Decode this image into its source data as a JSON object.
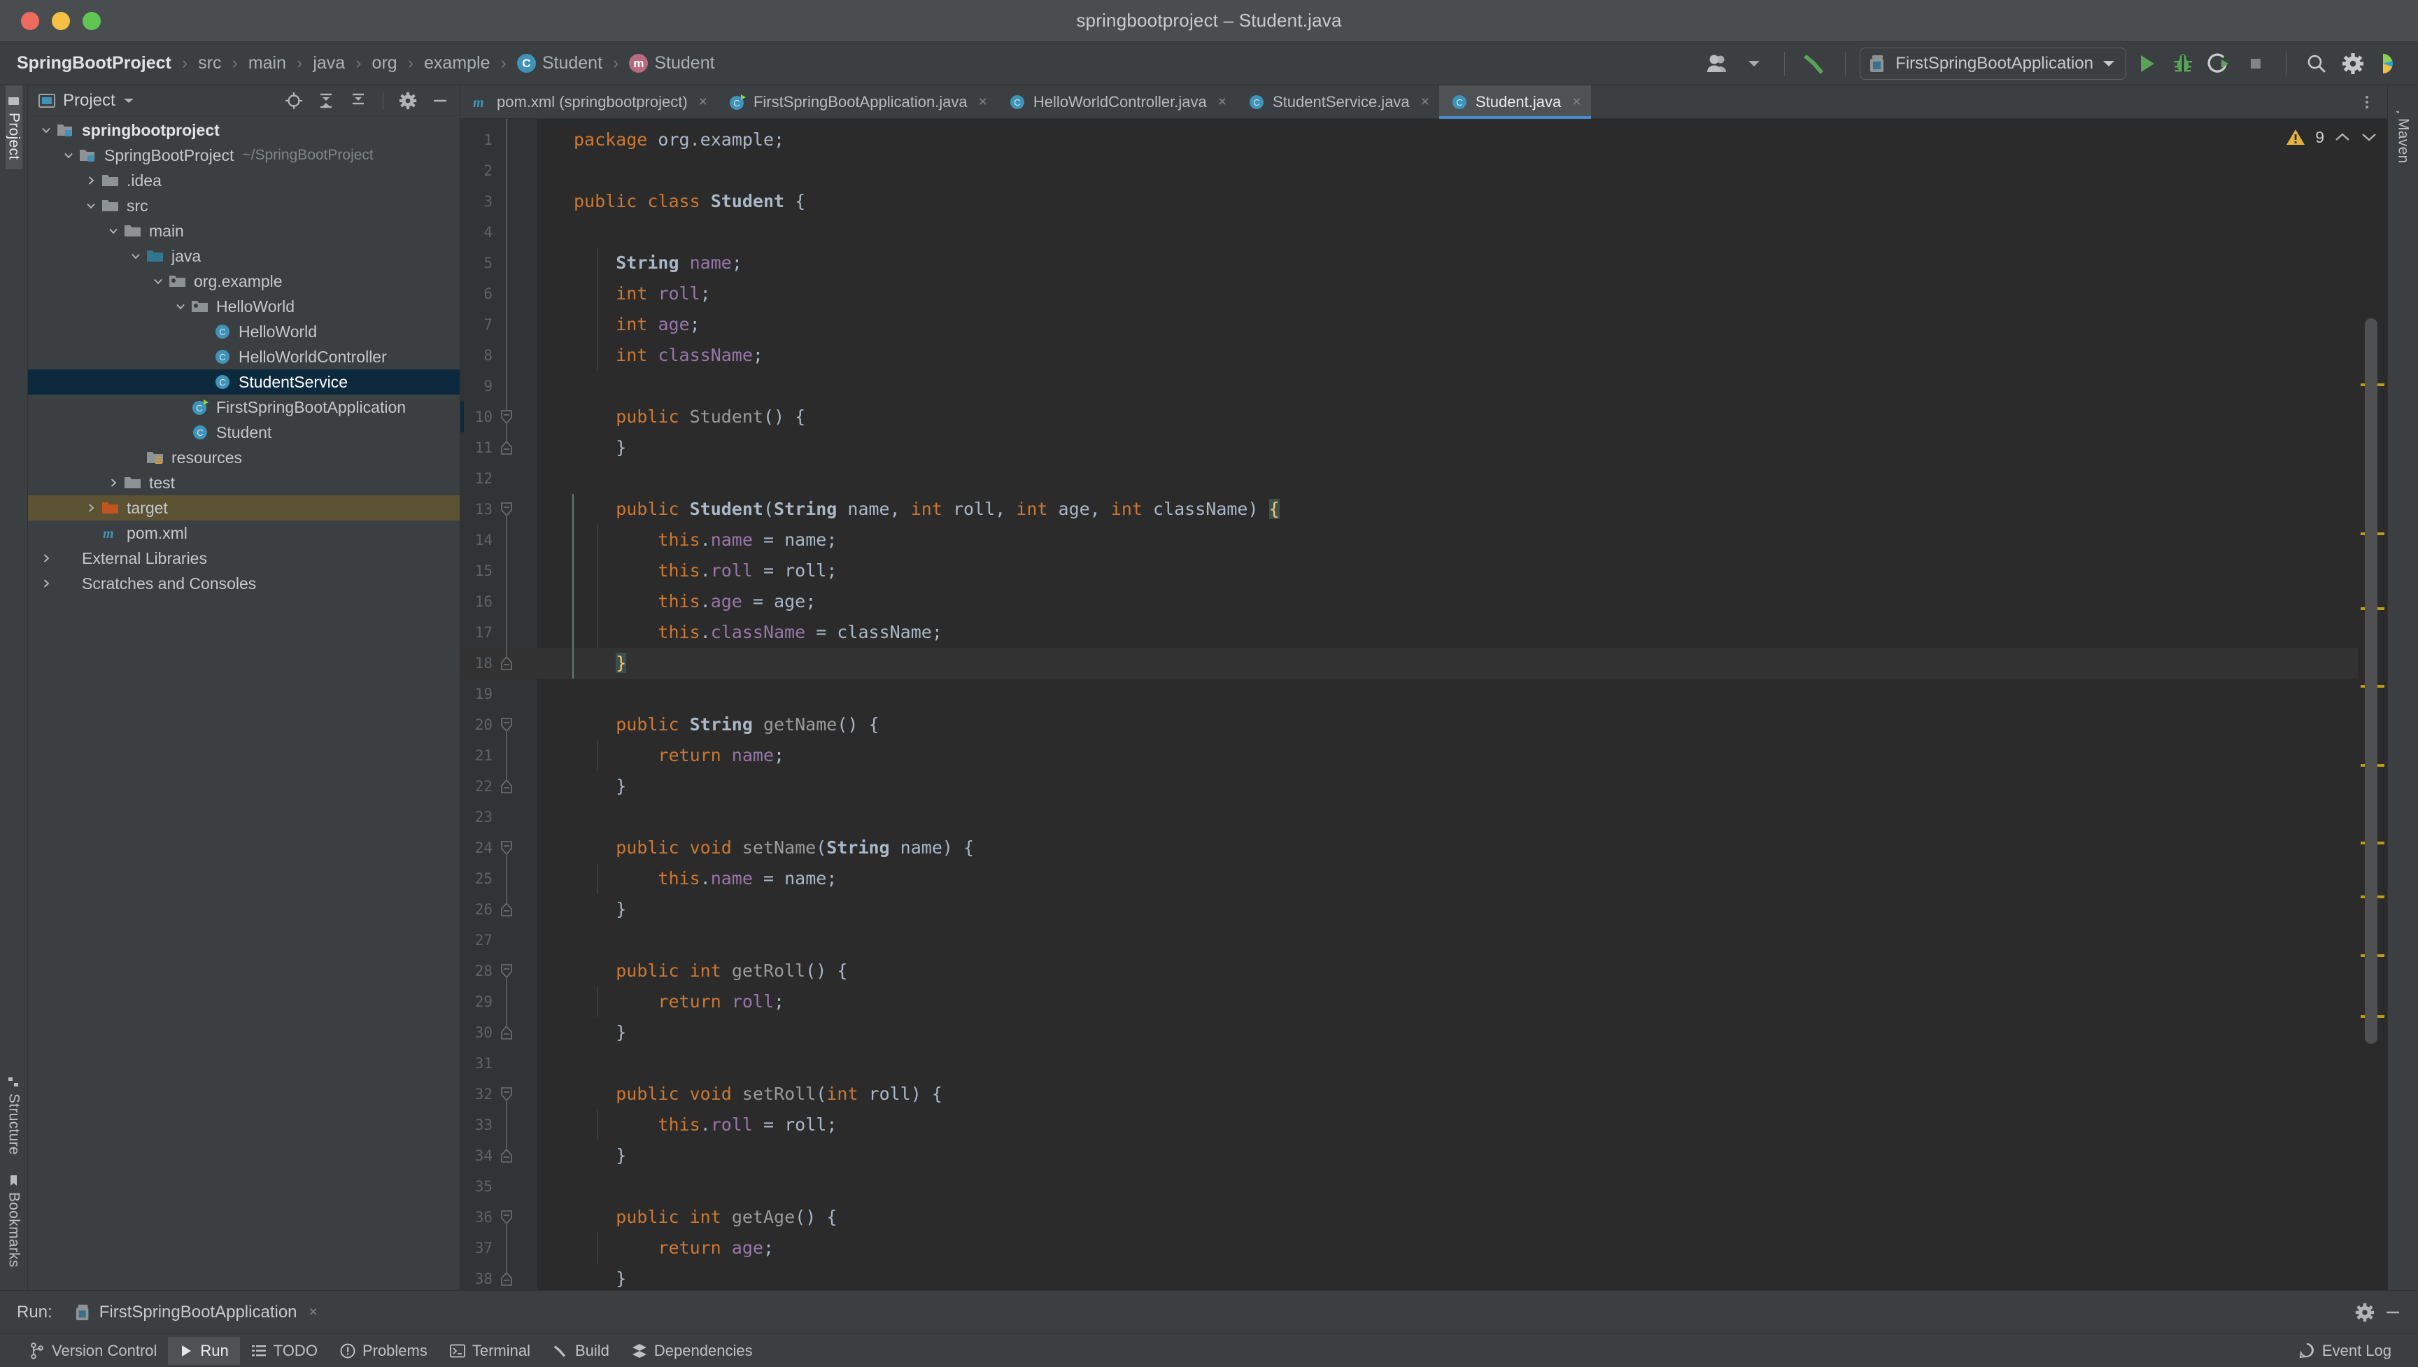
{
  "window": {
    "title": "springbootproject – Student.java",
    "controls": [
      "close",
      "minimize",
      "zoom"
    ]
  },
  "breadcrumb": {
    "items": [
      {
        "label": "SpringBootProject",
        "icon": null
      },
      {
        "label": "src",
        "icon": null
      },
      {
        "label": "main",
        "icon": null
      },
      {
        "label": "java",
        "icon": null
      },
      {
        "label": "org",
        "icon": null
      },
      {
        "label": "example",
        "icon": null
      },
      {
        "label": "Student",
        "icon": "class-badge"
      },
      {
        "label": "Student",
        "icon": "method-badge"
      }
    ],
    "separator": "›"
  },
  "toolbar": {
    "account_icon": "user-avatar-icon",
    "account_caret": "chevron-down-icon",
    "build_icon": "hammer-icon",
    "run_config": {
      "icon": "spring-boot-run-config-icon",
      "label": "FirstSpringBootApplication",
      "caret": "chevron-down-icon"
    },
    "run_icon": "run-play-icon",
    "debug_icon": "debug-bug-icon",
    "run_with_coverage_icon": "run-coverage-icon",
    "stop_icon": "stop-square-icon",
    "search_icon": "search-icon",
    "settings_icon": "gear-icon",
    "ai_icon": "ai-assistant-icon"
  },
  "left_tool_strip": {
    "tabs": [
      {
        "label": "Project",
        "icon": "project-icon",
        "active": true
      },
      {
        "label": "Structure",
        "icon": "structure-icon",
        "active": false
      },
      {
        "label": "Bookmarks",
        "icon": "bookmark-icon",
        "active": false
      }
    ]
  },
  "right_tool_strip": {
    "tabs": [
      {
        "label": "Maven",
        "icon": "maven-icon",
        "active": false
      }
    ]
  },
  "project_panel": {
    "title": "Project",
    "title_icon": "project-view-icon",
    "title_caret": "chevron-down-icon",
    "actions": [
      {
        "name": "select-opened-file-icon"
      },
      {
        "name": "expand-all-icon"
      },
      {
        "name": "collapse-all-icon"
      },
      {
        "name": "gear-icon"
      },
      {
        "name": "hide-icon"
      }
    ],
    "tree": [
      {
        "label": "springbootproject",
        "depth": 0,
        "twisty": "down",
        "icon": "module-folder",
        "bold": true,
        "state": "normal"
      },
      {
        "label": "SpringBootProject",
        "path": "~/SpringBootProject",
        "depth": 1,
        "twisty": "down",
        "icon": "module-folder",
        "bold": false,
        "state": "normal"
      },
      {
        "label": ".idea",
        "depth": 2,
        "twisty": "right",
        "icon": "folder",
        "state": "normal"
      },
      {
        "label": "src",
        "depth": 2,
        "twisty": "down",
        "icon": "folder",
        "state": "normal"
      },
      {
        "label": "main",
        "depth": 3,
        "twisty": "down",
        "icon": "folder",
        "state": "normal"
      },
      {
        "label": "java",
        "depth": 4,
        "twisty": "down",
        "icon": "source-folder",
        "state": "normal"
      },
      {
        "label": "org.example",
        "depth": 5,
        "twisty": "down",
        "icon": "package",
        "state": "normal"
      },
      {
        "label": "HelloWorld",
        "depth": 6,
        "twisty": "down",
        "icon": "package",
        "state": "normal"
      },
      {
        "label": "HelloWorld",
        "depth": 7,
        "twisty": "none",
        "icon": "java-class",
        "state": "normal"
      },
      {
        "label": "HelloWorldController",
        "depth": 7,
        "twisty": "none",
        "icon": "java-class",
        "state": "normal"
      },
      {
        "label": "StudentService",
        "depth": 7,
        "twisty": "none",
        "icon": "java-class",
        "state": "selected"
      },
      {
        "label": "FirstSpringBootApplication",
        "depth": 6,
        "twisty": "none",
        "icon": "spring-boot-class",
        "state": "normal"
      },
      {
        "label": "Student",
        "depth": 6,
        "twisty": "none",
        "icon": "java-class",
        "state": "normal"
      },
      {
        "label": "resources",
        "depth": 4,
        "twisty": "none",
        "icon": "resources-folder",
        "state": "normal"
      },
      {
        "label": "test",
        "depth": 3,
        "twisty": "right",
        "icon": "folder",
        "state": "normal"
      },
      {
        "label": "target",
        "depth": 2,
        "twisty": "right",
        "icon": "excluded-folder",
        "state": "marked"
      },
      {
        "label": "pom.xml",
        "depth": 2,
        "twisty": "none",
        "icon": "maven-file",
        "state": "normal"
      },
      {
        "label": "External Libraries",
        "depth": 0,
        "twisty": "right",
        "icon": "libraries-icon",
        "state": "normal"
      },
      {
        "label": "Scratches and Consoles",
        "depth": 0,
        "twisty": "right",
        "icon": "scratches-icon",
        "state": "normal"
      }
    ]
  },
  "editor_tabs": [
    {
      "label": "pom.xml (springbootproject)",
      "icon": "maven-file",
      "active": false,
      "close": "×"
    },
    {
      "label": "FirstSpringBootApplication.java",
      "icon": "spring-boot-class",
      "active": false,
      "close": "×"
    },
    {
      "label": "HelloWorldController.java",
      "icon": "java-class",
      "active": false,
      "close": "×"
    },
    {
      "label": "StudentService.java",
      "icon": "java-class",
      "active": false,
      "close": "×"
    },
    {
      "label": "Student.java",
      "icon": "java-class",
      "active": true,
      "close": "×"
    }
  ],
  "editor": {
    "file": "Student.java",
    "first_visible_line": 1,
    "last_visible_line": 38,
    "caret_line": 18,
    "inspections": {
      "icon": "warning-triangle-icon",
      "count": "9",
      "prev_icon": "chevron-up-icon",
      "next_icon": "chevron-down-icon"
    },
    "lines": [
      {
        "n": 1,
        "text": "package org.example;",
        "fold": "none"
      },
      {
        "n": 2,
        "text": "",
        "fold": "none"
      },
      {
        "n": 3,
        "text": "public class Student {",
        "fold": "none"
      },
      {
        "n": 4,
        "text": "",
        "fold": "none"
      },
      {
        "n": 5,
        "text": "    String name;",
        "fold": "none"
      },
      {
        "n": 6,
        "text": "    int roll;",
        "fold": "none"
      },
      {
        "n": 7,
        "text": "    int age;",
        "fold": "none"
      },
      {
        "n": 8,
        "text": "    int className;",
        "fold": "none"
      },
      {
        "n": 9,
        "text": "",
        "fold": "none"
      },
      {
        "n": 10,
        "text": "    public Student() {",
        "fold": "start"
      },
      {
        "n": 11,
        "text": "    }",
        "fold": "end"
      },
      {
        "n": 12,
        "text": "",
        "fold": "none"
      },
      {
        "n": 13,
        "text": "    public Student(String name, int roll, int age, int className) {",
        "fold": "start"
      },
      {
        "n": 14,
        "text": "        this.name = name;",
        "fold": "none"
      },
      {
        "n": 15,
        "text": "        this.roll = roll;",
        "fold": "none"
      },
      {
        "n": 16,
        "text": "        this.age = age;",
        "fold": "none"
      },
      {
        "n": 17,
        "text": "        this.className = className;",
        "fold": "none"
      },
      {
        "n": 18,
        "text": "    }",
        "fold": "end"
      },
      {
        "n": 19,
        "text": "",
        "fold": "none"
      },
      {
        "n": 20,
        "text": "    public String getName() {",
        "fold": "start"
      },
      {
        "n": 21,
        "text": "        return name;",
        "fold": "none"
      },
      {
        "n": 22,
        "text": "    }",
        "fold": "end"
      },
      {
        "n": 23,
        "text": "",
        "fold": "none"
      },
      {
        "n": 24,
        "text": "    public void setName(String name) {",
        "fold": "start"
      },
      {
        "n": 25,
        "text": "        this.name = name;",
        "fold": "none"
      },
      {
        "n": 26,
        "text": "    }",
        "fold": "end"
      },
      {
        "n": 27,
        "text": "",
        "fold": "none"
      },
      {
        "n": 28,
        "text": "    public int getRoll() {",
        "fold": "start"
      },
      {
        "n": 29,
        "text": "        return roll;",
        "fold": "none"
      },
      {
        "n": 30,
        "text": "    }",
        "fold": "end"
      },
      {
        "n": 31,
        "text": "",
        "fold": "none"
      },
      {
        "n": 32,
        "text": "    public void setRoll(int roll) {",
        "fold": "start"
      },
      {
        "n": 33,
        "text": "        this.roll = roll;",
        "fold": "none"
      },
      {
        "n": 34,
        "text": "    }",
        "fold": "end"
      },
      {
        "n": 35,
        "text": "",
        "fold": "none"
      },
      {
        "n": 36,
        "text": "    public int getAge() {",
        "fold": "start"
      },
      {
        "n": 37,
        "text": "        return age;",
        "fold": "none"
      },
      {
        "n": 38,
        "text": "    }",
        "fold": "end"
      }
    ],
    "scrollbar_markers_y": [
      226,
      353,
      417,
      483,
      551,
      617,
      663,
      713,
      765
    ]
  },
  "run_panel": {
    "label": "Run:",
    "tab": {
      "label": "FirstSpringBootApplication",
      "icon": "spring-boot-run-config-icon",
      "close": "×"
    },
    "settings_icon": "gear-icon",
    "hide_icon": "hide-icon"
  },
  "status_bar": {
    "items": [
      {
        "label": "Version Control",
        "icon": "branch-icon",
        "active": false
      },
      {
        "label": "Run",
        "icon": "run-play-icon",
        "active": true
      },
      {
        "label": "TODO",
        "icon": "todo-list-icon",
        "active": false
      },
      {
        "label": "Problems",
        "icon": "problems-icon",
        "active": false
      },
      {
        "label": "Terminal",
        "icon": "terminal-icon",
        "active": false
      },
      {
        "label": "Build",
        "icon": "hammer-icon",
        "active": false
      },
      {
        "label": "Dependencies",
        "icon": "dependencies-icon",
        "active": false
      }
    ],
    "right": {
      "label": "Event Log",
      "icon": "event-log-icon"
    }
  },
  "colors": {
    "accent": "#4a88c7",
    "selection": "#0d293e",
    "warning": "#bd9b16",
    "keyword": "#cc7832",
    "field": "#9876aa",
    "method": "#9a9a9a",
    "text": "#a9b7c6",
    "editor_bg": "#2b2b2b",
    "panel_bg": "#3c3f41"
  }
}
